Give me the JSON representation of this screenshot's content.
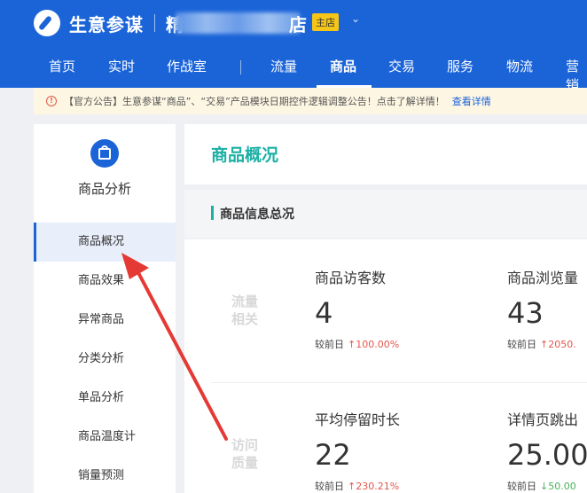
{
  "header": {
    "brand": "生意参谋",
    "shop_prefix": "精",
    "shop_suffix": "店",
    "store_badge": "主店",
    "chevron_icon": "chevron-down-icon"
  },
  "nav": {
    "items": [
      "首页",
      "实时",
      "作战室",
      "流量",
      "商品",
      "交易",
      "服务",
      "物流",
      "营销"
    ],
    "active": "商品"
  },
  "notice": {
    "text": "【官方公告】生意参谋“商品”、“交易”产品模块日期控件逻辑调整公告！点击了解详情！",
    "link": "查看详情"
  },
  "sidebar": {
    "title": "商品分析",
    "items": [
      "商品概况",
      "商品效果",
      "异常商品",
      "分类分析",
      "单品分析",
      "商品温度计",
      "销量预测"
    ],
    "active_index": 0
  },
  "main": {
    "title": "商品概况",
    "section_title": "商品信息总况",
    "rows": [
      {
        "label_line1": "流量",
        "label_line2": "相关",
        "metrics": [
          {
            "name": "商品访客数",
            "value": "4",
            "compare_label": "较前日",
            "change": "100.00%",
            "direction": "up"
          },
          {
            "name": "商品浏览量",
            "value": "43",
            "compare_label": "较前日",
            "change": "2050.",
            "direction": "up"
          }
        ]
      },
      {
        "label_line1": "访问",
        "label_line2": "质量",
        "metrics": [
          {
            "name": "平均停留时长",
            "value": "22",
            "compare_label": "较前日",
            "change": "230.21%",
            "direction": "up"
          },
          {
            "name": "详情页跳出",
            "value": "25.00",
            "compare_label": "较前日",
            "change": "50.00",
            "direction": "down"
          }
        ]
      }
    ]
  },
  "colors": {
    "header_blue": "#1b64d8",
    "accent_teal": "#1bb0a5",
    "up_red": "#e2574c",
    "down_green": "#47b35a",
    "annotation_red": "#e53935"
  }
}
